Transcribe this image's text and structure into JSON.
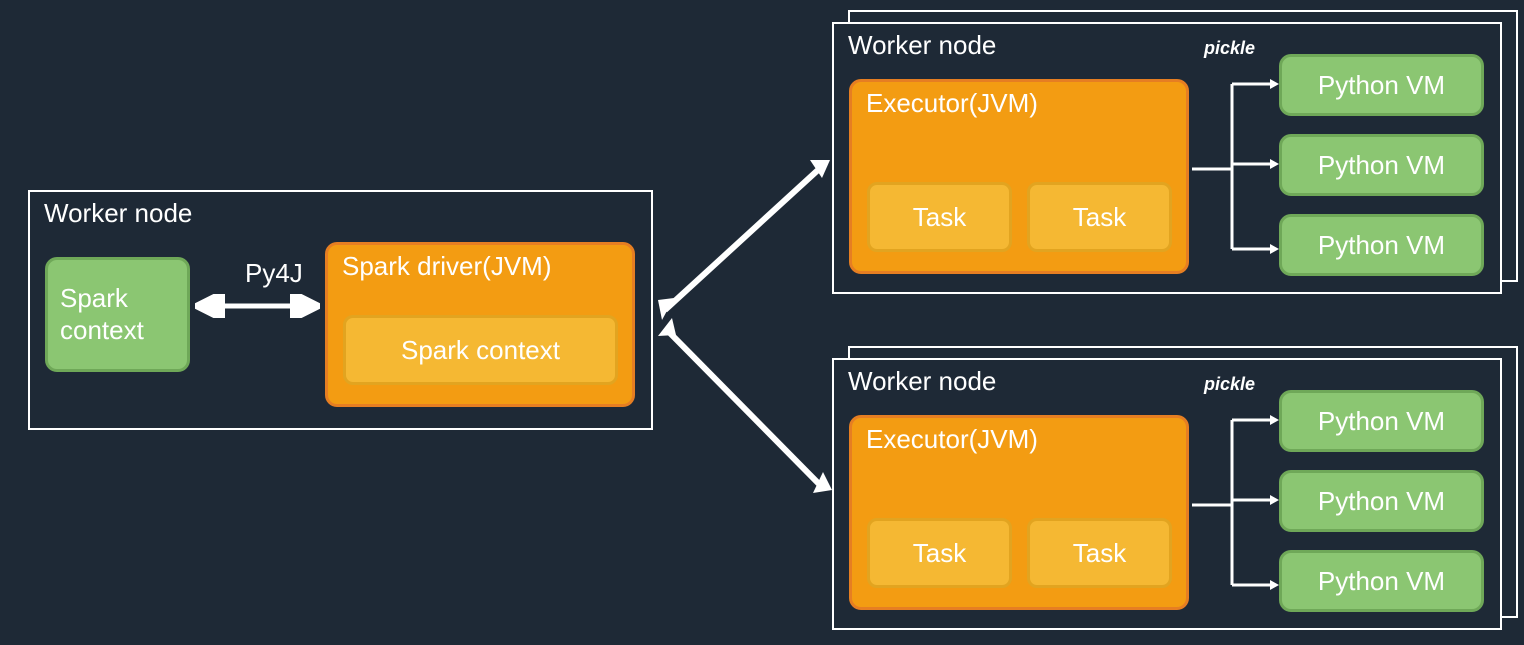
{
  "driver": {
    "worker_label": "Worker node",
    "spark_context_green": "Spark\ncontext",
    "py4j": "Py4J",
    "spark_driver": "Spark driver(JVM)",
    "spark_context_yellow": "Spark context"
  },
  "worker1": {
    "worker_label": "Worker node",
    "executor": "Executor(JVM)",
    "task1": "Task",
    "task2": "Task",
    "pickle": "pickle",
    "pyvm1": "Python VM",
    "pyvm2": "Python VM",
    "pyvm3": "Python VM"
  },
  "worker2": {
    "worker_label": "Worker node",
    "executor": "Executor(JVM)",
    "task1": "Task",
    "task2": "Task",
    "pickle": "pickle",
    "pyvm1": "Python VM",
    "pyvm2": "Python VM",
    "pyvm3": "Python VM"
  }
}
